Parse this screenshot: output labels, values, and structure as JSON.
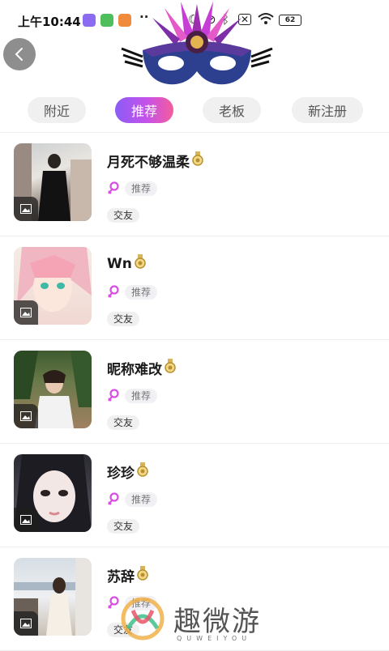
{
  "status_bar": {
    "time": "上午10:44",
    "battery": "62",
    "more": "··"
  },
  "tabs": [
    {
      "label": "附近",
      "active": false
    },
    {
      "label": "推荐",
      "active": true
    },
    {
      "label": "老板",
      "active": false
    },
    {
      "label": "新注册",
      "active": false
    }
  ],
  "users": [
    {
      "name": "月死不够温柔",
      "badge": "推荐",
      "tag": "交友"
    },
    {
      "name": "Wn",
      "badge": "推荐",
      "tag": "交友"
    },
    {
      "name": "昵称难改",
      "badge": "推荐",
      "tag": "交友"
    },
    {
      "name": "珍珍",
      "badge": "推荐",
      "tag": "交友"
    },
    {
      "name": "苏辞",
      "badge": "推荐",
      "tag": "交友"
    }
  ],
  "watermark": {
    "text": "趣微游",
    "sub": "QUWEIYOU"
  },
  "colors": {
    "accent_start": "#8a5cf6",
    "accent_end": "#f45c9c",
    "gender": "#d54fe0"
  }
}
